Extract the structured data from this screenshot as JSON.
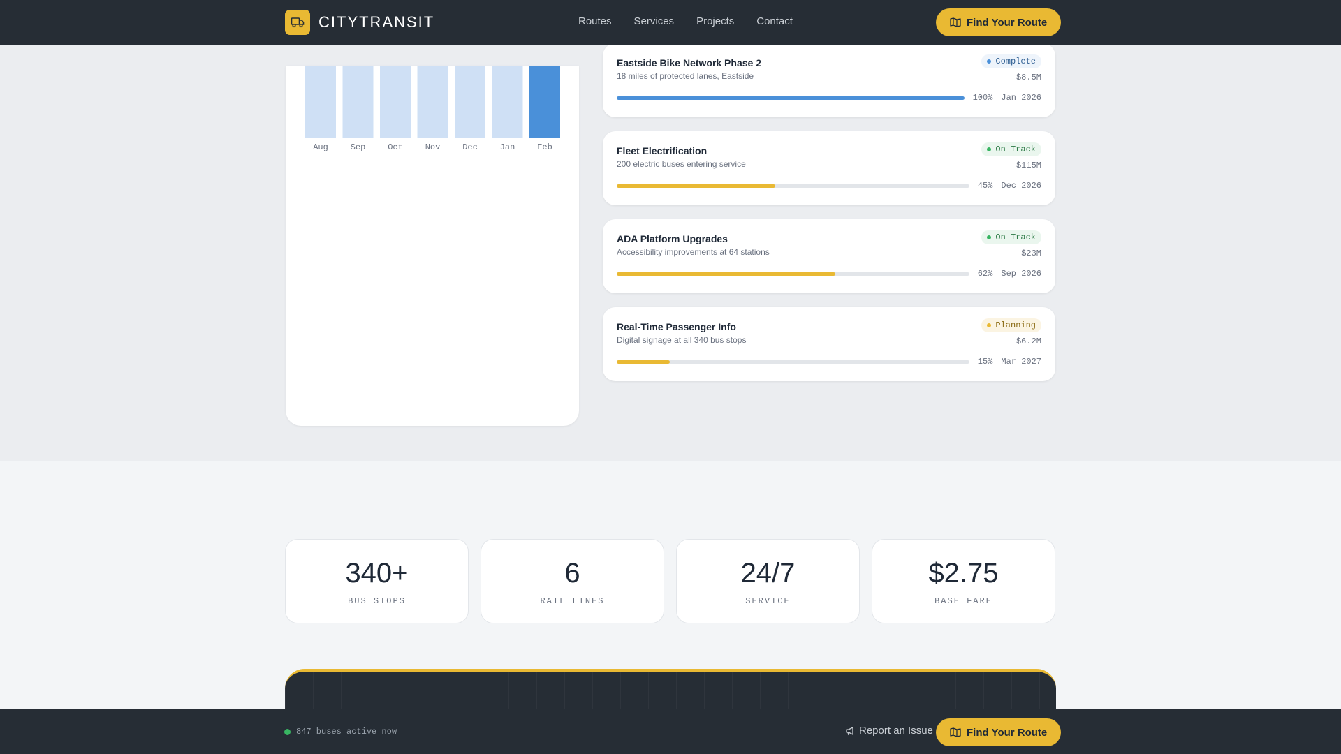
{
  "header": {
    "brand": "CITYTRANSIT",
    "nav": [
      "Routes",
      "Services",
      "Projects",
      "Contact"
    ],
    "cta_label": "Find Your Route"
  },
  "chart_data": {
    "type": "bar",
    "categories": [
      "Aug",
      "Sep",
      "Oct",
      "Nov",
      "Dec",
      "Jan",
      "Feb"
    ],
    "highlight_index": 6,
    "colors": {
      "default": "#cfe0f5",
      "highlight": "#4a90d9"
    }
  },
  "projects": [
    {
      "title": "Eastside Bike Network Phase 2",
      "desc": "18 miles of protected lanes, Eastside",
      "status": "Complete",
      "status_type": "complete",
      "cost": "$8.5M",
      "progress_label": "100%",
      "progress": 100,
      "date": "Jan 2026",
      "bar_color": "#4a90d9"
    },
    {
      "title": "Fleet Electrification",
      "desc": "200 electric buses entering service",
      "status": "On Track",
      "status_type": "ontrack",
      "cost": "$115M",
      "progress_label": "45%",
      "progress": 45,
      "date": "Dec 2026",
      "bar_color": "#e9b933"
    },
    {
      "title": "ADA Platform Upgrades",
      "desc": "Accessibility improvements at 64 stations",
      "status": "On Track",
      "status_type": "ontrack",
      "cost": "$23M",
      "progress_label": "62%",
      "progress": 62,
      "date": "Sep 2026",
      "bar_color": "#e9b933"
    },
    {
      "title": "Real-Time Passenger Info",
      "desc": "Digital signage at all 340 bus stops",
      "status": "Planning",
      "status_type": "planning",
      "cost": "$6.2M",
      "progress_label": "15%",
      "progress": 15,
      "date": "Mar 2027",
      "bar_color": "#e9b933"
    }
  ],
  "stats": [
    {
      "value": "340+",
      "label": "BUS STOPS"
    },
    {
      "value": "6",
      "label": "RAIL LINES"
    },
    {
      "value": "24/7",
      "label": "SERVICE"
    },
    {
      "value": "$2.75",
      "label": "BASE FARE"
    }
  ],
  "bottom_bar": {
    "live_text": "847 buses active now",
    "report_label": "Report an Issue",
    "cta_label": "Find Your Route"
  },
  "colors": {
    "accent": "#e9b933",
    "dark": "#262d35",
    "blue": "#4a90d9",
    "green": "#38b562"
  },
  "icons": {
    "logo": "bus-icon",
    "cta": "map-icon",
    "report": "megaphone-icon"
  }
}
